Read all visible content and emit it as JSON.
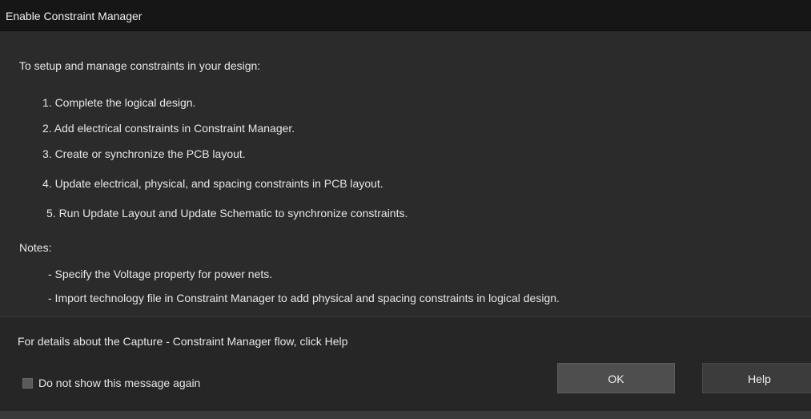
{
  "window": {
    "title": "Enable Constraint Manager"
  },
  "content": {
    "intro": "To setup and manage constraints in your design:",
    "steps": [
      "1. Complete the logical design.",
      "2. Add electrical constraints in Constraint Manager.",
      "3. Create or synchronize the PCB layout.",
      "4. Update electrical, physical, and spacing constraints in PCB layout.",
      "5. Run Update Layout and Update Schematic to synchronize constraints."
    ],
    "notes_label": "Notes:",
    "notes": [
      "- Specify the Voltage property for power nets.",
      "- Import technology file in Constraint Manager to add physical and spacing constraints in logical design."
    ]
  },
  "footer": {
    "details": "For details about the Capture - Constraint Manager flow, click Help",
    "checkbox_label": "Do not show this message again",
    "checkbox_checked": false,
    "ok_label": "OK",
    "help_label": "Help"
  }
}
